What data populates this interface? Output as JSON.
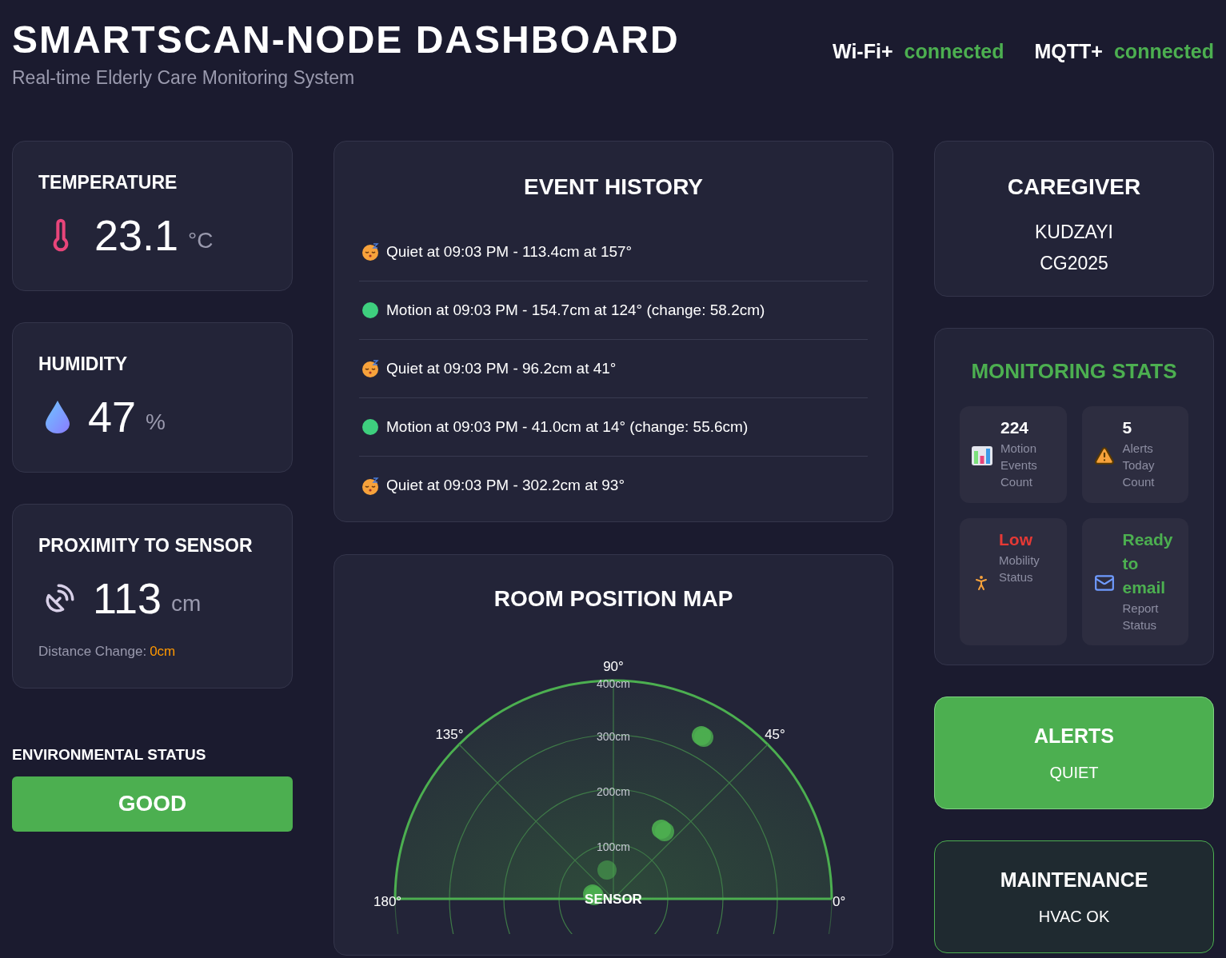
{
  "header": {
    "title": "SMARTSCAN-NODE DASHBOARD",
    "subtitle": "Real-time Elderly Care Monitoring System",
    "connections": [
      {
        "label": "Wi-Fi+",
        "status": "connected"
      },
      {
        "label": "MQTT+",
        "status": "connected"
      }
    ]
  },
  "sensors": [
    {
      "kind": "temperature",
      "title": "TEMPERATURE",
      "value": "23.1",
      "unit": "°C"
    },
    {
      "kind": "humidity",
      "title": "HUMIDITY",
      "value": "47",
      "unit": "%"
    },
    {
      "kind": "proximity",
      "title": "PROXIMITY TO SENSOR",
      "value": "113",
      "unit": "cm",
      "note_label": "Distance Change:",
      "note_value": "0cm"
    }
  ],
  "environmental_status": {
    "label": "ENVIRONMENTAL STATUS",
    "value": "GOOD"
  },
  "event_history": {
    "title": "EVENT HISTORY",
    "events": [
      {
        "kind": "quiet",
        "text": "Quiet at 09:03 PM - 113.4cm at 157°"
      },
      {
        "kind": "motion",
        "text": "Motion at 09:03 PM - 154.7cm at 124° (change: 58.2cm)"
      },
      {
        "kind": "quiet",
        "text": "Quiet at 09:03 PM - 96.2cm at 41°"
      },
      {
        "kind": "motion",
        "text": "Motion at 09:03 PM - 41.0cm at 14° (change: 55.6cm)"
      },
      {
        "kind": "quiet",
        "text": "Quiet at 09:03 PM - 302.2cm at 93°"
      }
    ]
  },
  "room_map": {
    "title": "ROOM POSITION MAP",
    "angle_labels": [
      "90°",
      "135°",
      "45°",
      "180°",
      "0°"
    ],
    "ring_labels": [
      "400cm",
      "300cm",
      "200cm",
      "100cm"
    ],
    "center_label": "SENSOR"
  },
  "caregiver": {
    "title": "CAREGIVER",
    "name": "KUDZAYI",
    "id": "CG2025"
  },
  "monitoring_stats": {
    "title": "MONITORING STATS",
    "items": [
      {
        "kind": "chart",
        "value": "224",
        "label": "Motion Events Count",
        "color": "#ffffff"
      },
      {
        "kind": "warning",
        "value": "5",
        "label": "Alerts Today Count",
        "color": "#ffffff"
      },
      {
        "kind": "walking",
        "value": "Low",
        "label": "Mobility Status",
        "color": "#e53935"
      },
      {
        "kind": "mail",
        "value": "Ready to email",
        "label": "Report Status",
        "color": "#4caf50"
      }
    ]
  },
  "alerts": {
    "title": "ALERTS",
    "value": "QUIET"
  },
  "maintenance": {
    "title": "MAINTENANCE",
    "value": "HVAC OK"
  }
}
